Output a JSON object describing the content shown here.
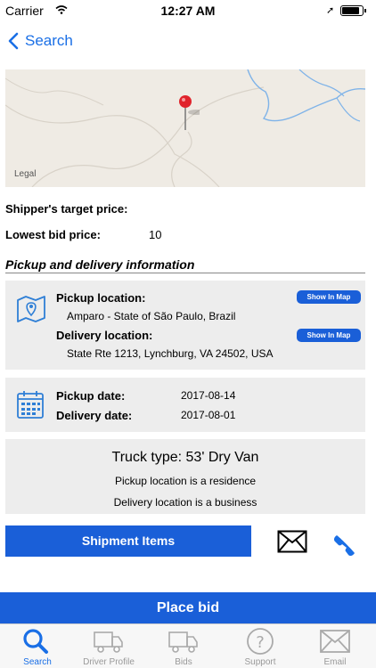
{
  "status_bar": {
    "carrier": "Carrier",
    "time": "12:27 AM"
  },
  "nav": {
    "back_label": "Search"
  },
  "map": {
    "legal": "Legal"
  },
  "prices": {
    "target_label": "Shipper's target price:",
    "lowest_label": "Lowest bid price:",
    "lowest_value": "10"
  },
  "section_title": "Pickup and delivery information",
  "locations": {
    "pickup_label": "Pickup location:",
    "pickup_value": "Amparo - State of São Paulo, Brazil",
    "delivery_label": "Delivery location:",
    "delivery_value": "State Rte 1213, Lynchburg, VA 24502, USA",
    "show_map_label": "Show In Map"
  },
  "dates": {
    "pickup_label": "Pickup date:",
    "pickup_value": "2017-08-14",
    "delivery_label": "Delivery date:",
    "delivery_value": "2017-08-01"
  },
  "truck": {
    "type": "Truck type: 53' Dry Van",
    "pickup_note": "Pickup location is a residence",
    "delivery_note": "Delivery location is a business"
  },
  "actions": {
    "shipment_items": "Shipment Items",
    "place_bid": "Place bid"
  },
  "tabs": [
    {
      "label": "Search",
      "icon": "search-icon",
      "active": true
    },
    {
      "label": "Driver Profile",
      "icon": "truck-icon",
      "active": false
    },
    {
      "label": "Bids",
      "icon": "truck-icon",
      "active": false
    },
    {
      "label": "Support",
      "icon": "question-icon",
      "active": false
    },
    {
      "label": "Email",
      "icon": "mail-icon",
      "active": false
    }
  ],
  "colors": {
    "accent": "#1a5fd8",
    "link": "#1a6fe6",
    "card": "#ededed",
    "pin": "#e0242c"
  }
}
